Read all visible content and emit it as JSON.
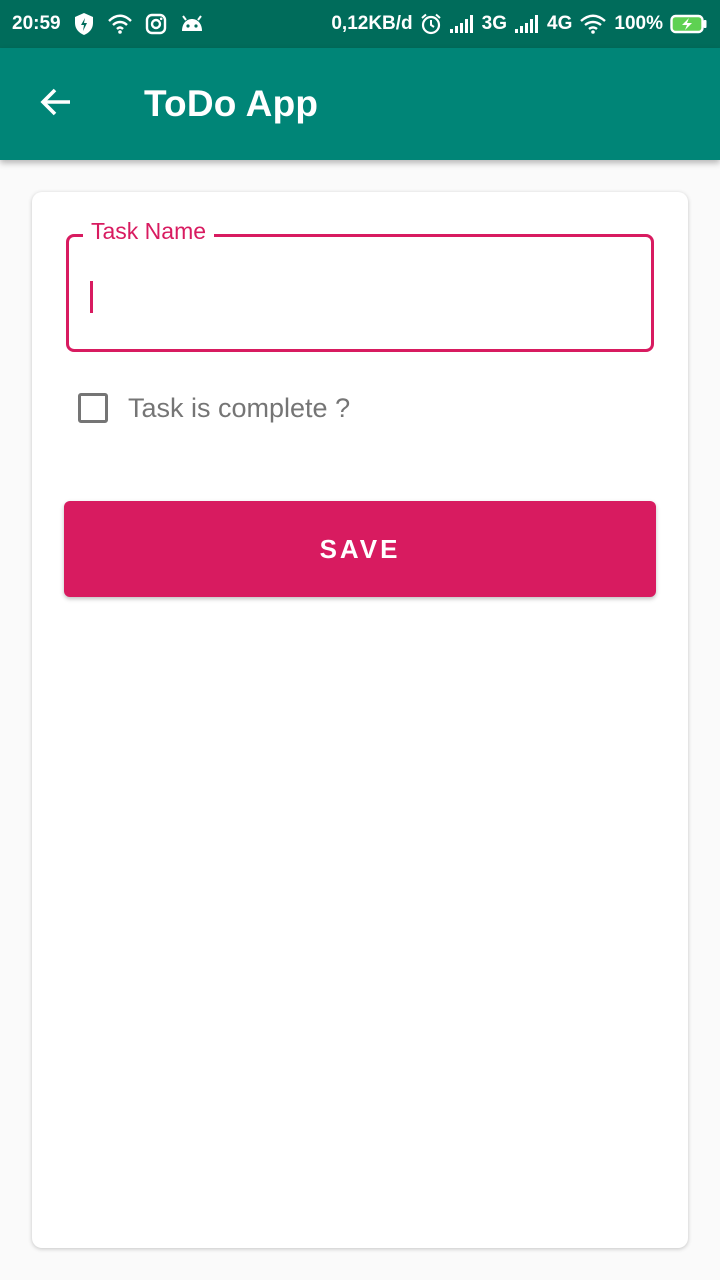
{
  "status_bar": {
    "time": "20:59",
    "network_speed": "0,12KB/d",
    "network_3g": "3G",
    "network_4g": "4G",
    "battery": "100%",
    "left_icons": [
      "shield-icon",
      "wifi-icon",
      "instagram-icon",
      "android-icon"
    ],
    "right_icons": [
      "alarm-icon",
      "signal-icon",
      "signal-icon",
      "wifi-icon",
      "battery-charging-icon"
    ]
  },
  "app_bar": {
    "title": "ToDo App",
    "back_icon": "arrow-back-icon"
  },
  "form": {
    "task_name": {
      "label": "Task Name",
      "value": "",
      "placeholder": ""
    },
    "complete_checkbox": {
      "label": "Task is complete ?",
      "checked": false
    },
    "save_label": "SAVE"
  },
  "colors": {
    "status_bar": "#006c5b",
    "app_bar": "#008577",
    "accent": "#d81b60",
    "background": "#fafafa",
    "card": "#ffffff",
    "secondary_text": "#757575"
  }
}
